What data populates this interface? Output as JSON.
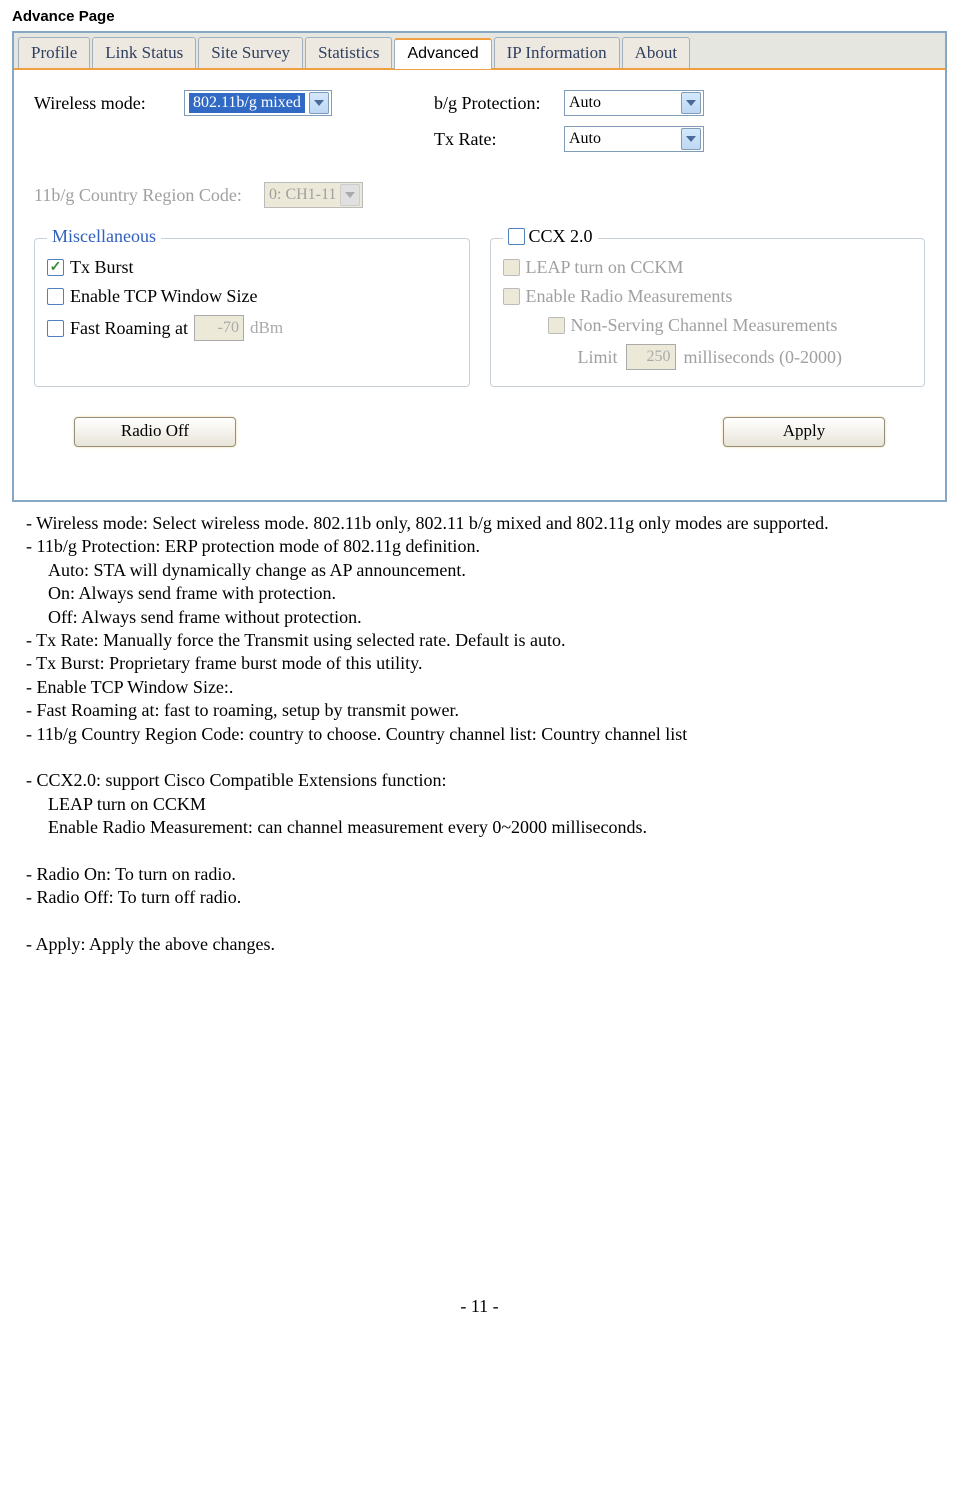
{
  "page_title": "Advance Page",
  "tabs": [
    "Profile",
    "Link Status",
    "Site Survey",
    "Statistics",
    "Advanced",
    "IP Information",
    "About"
  ],
  "active_tab": "Advanced",
  "fields": {
    "wireless_mode_label": "Wireless mode:",
    "wireless_mode_value": "802.11b/g mixed",
    "bg_protection_label": "b/g Protection:",
    "bg_protection_value": "Auto",
    "tx_rate_label": "Tx Rate:",
    "tx_rate_value": "Auto",
    "country_label": "11b/g Country Region Code:",
    "country_value": "0: CH1-11"
  },
  "misc": {
    "legend": "Miscellaneous",
    "tx_burst": "Tx Burst",
    "tcp_window": "Enable TCP Window Size",
    "fast_roaming": "Fast Roaming at",
    "fast_roaming_value": "-70",
    "fast_roaming_unit": "dBm"
  },
  "ccx": {
    "legend": "CCX 2.0",
    "leap": "LEAP turn on CCKM",
    "radio_meas": "Enable Radio Measurements",
    "non_serving": "Non-Serving Channel Measurements",
    "limit_label": "Limit",
    "limit_value": "250",
    "limit_unit": "milliseconds (0-2000)"
  },
  "buttons": {
    "radio_off": "Radio Off",
    "apply": "Apply"
  },
  "desc": {
    "l1": "- Wireless mode: Select wireless mode. 802.11b only, 802.11 b/g mixed and 802.11g only modes are supported.",
    "l2": "- 11b/g Protection: ERP protection mode of 802.11g definition.",
    "l2a": "Auto: STA will dynamically change as AP announcement.",
    "l2b": "On: Always send frame with protection.",
    "l2c": "Off: Always send frame without protection.",
    "l3": "- Tx Rate: Manually force the Transmit using selected rate. Default is auto.",
    "l4": "- Tx Burst: Proprietary frame burst mode of this utility.",
    "l5": "- Enable TCP Window Size:.",
    "l6": "- Fast Roaming at: fast to roaming, setup by transmit power.",
    "l7": "- 11b/g Country Region Code: country to choose. Country channel list: Country channel list",
    "l8": "- CCX2.0: support Cisco Compatible Extensions function:",
    "l8a": "LEAP turn on CCKM",
    "l8b": "Enable Radio Measurement: can channel measurement every 0~2000 milliseconds.",
    "l9": "- Radio On: To turn on radio.",
    "l10": "- Radio Off: To turn off radio.",
    "l11": "- Apply: Apply the above changes."
  },
  "footer": "- 11 -"
}
